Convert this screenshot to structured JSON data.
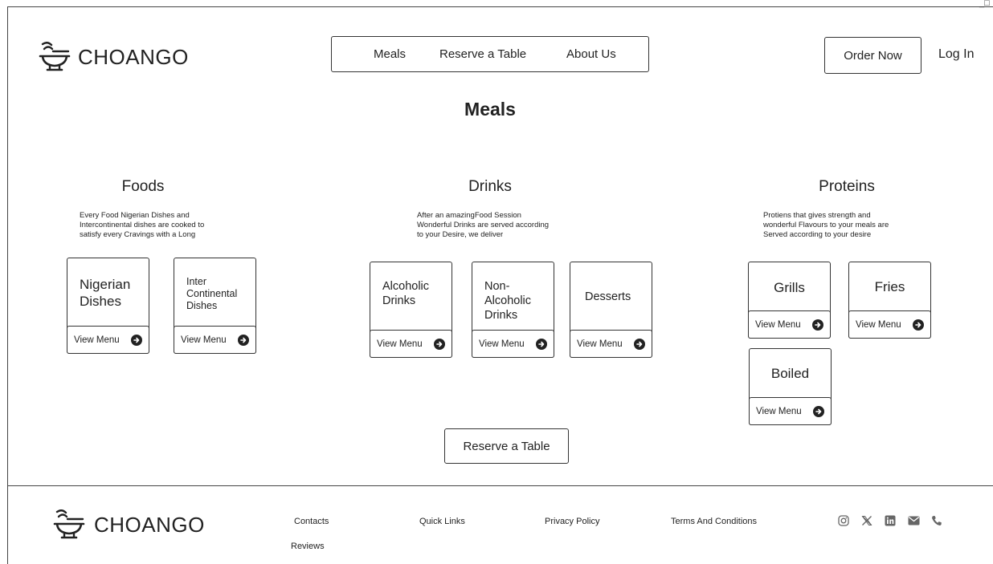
{
  "header": {
    "brand": "CHOANGO",
    "nav": [
      "Meals",
      "Reserve a Table",
      "About Us"
    ],
    "order_label": "Order Now",
    "login_label": "Log In",
    "window_controls": "_□"
  },
  "page_title": "Meals",
  "sections": {
    "foods": {
      "title": "Foods",
      "desc": [
        "Every Food Nigerian Dishes and",
        "Intercontinental dishes are cooked to",
        "satisfy every Cravings with a Long"
      ],
      "cards": [
        {
          "lines": [
            "Nigerian",
            "Dishes"
          ],
          "action": "View Menu"
        },
        {
          "lines": [
            "Inter",
            "Continental",
            "Dishes"
          ],
          "action": "View Menu"
        }
      ]
    },
    "drinks": {
      "title": "Drinks",
      "desc": [
        "After an amazingFood Session",
        "Wonderful Drinks are served according",
        "to your Desire, we deliver"
      ],
      "cards": [
        {
          "lines": [
            "Alcoholic",
            "Drinks"
          ],
          "action": "View Menu"
        },
        {
          "lines": [
            "Non-",
            "Alcoholic",
            "Drinks"
          ],
          "action": "View Menu"
        },
        {
          "lines": [
            "Desserts"
          ],
          "action": "View Menu"
        }
      ]
    },
    "proteins": {
      "title": "Proteins",
      "desc": [
        "Protiens that gives strength and",
        "wonderful Flavours to your meals are",
        "Served according to your desire"
      ],
      "cards": [
        {
          "lines": [
            "Grills"
          ],
          "action": "View Menu"
        },
        {
          "lines": [
            "Fries"
          ],
          "action": "View Menu"
        },
        {
          "lines": [
            "Boiled"
          ],
          "action": "View Menu"
        }
      ]
    }
  },
  "reserve_label": "Reserve a Table",
  "footer": {
    "brand": "CHOANGO",
    "links": [
      "Contacts",
      "Quick Links",
      "Privacy Policy",
      "Terms And Conditions",
      "Reviews"
    ],
    "social_icons": [
      "instagram-icon",
      "x-icon",
      "linkedin-icon",
      "mail-icon",
      "phone-icon"
    ]
  }
}
